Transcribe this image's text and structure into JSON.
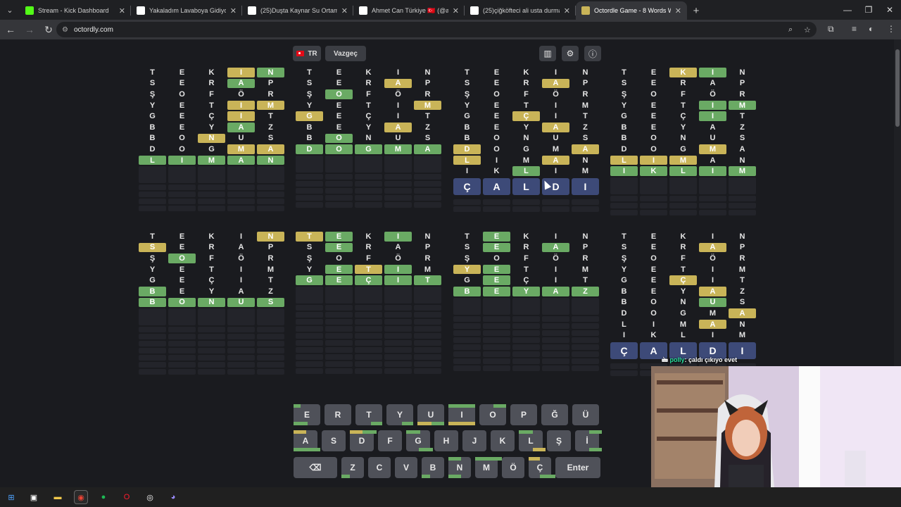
{
  "browser": {
    "tabs": [
      {
        "title": "Stream - Kick Dashboard",
        "icon": "kick-icon",
        "color": "#53fc18",
        "active": false
      },
      {
        "title": "Yakaladım Lavaboya Gidiyor, Ha",
        "icon": "tiktok-icon",
        "color": "#ffffff",
        "active": false
      },
      {
        "title": "(25)Duşta Kaynar Su Ortamı De",
        "icon": "tiktok-icon",
        "color": "#ffffff",
        "active": false
      },
      {
        "title": "Ahmet Can Türkiye 🇹🇷 (@ahmet",
        "icon": "tiktok-icon",
        "color": "#ffffff",
        "active": false
      },
      {
        "title": "(25)çiğköfteci ali usta durma de",
        "icon": "tiktok-icon",
        "color": "#ffffff",
        "active": false
      },
      {
        "title": "Octordle Game - 8 Words Word",
        "icon": "octordle-icon",
        "color": "#c9b458",
        "active": true
      }
    ],
    "url": "octordly.com"
  },
  "header": {
    "lang_label": "TR",
    "giveup_label": "Vazgeç",
    "icons": [
      "stats-icon",
      "gear-icon",
      "info-icon"
    ]
  },
  "colors": {
    "green": "#6aaa64",
    "yellow": "#c9b458",
    "current": "#3d4a78",
    "key": "#4f5159"
  },
  "boards": [
    {
      "rows": [
        [
          "T.",
          "E.",
          "K.",
          "Iy",
          "Ng"
        ],
        [
          "S.",
          "E.",
          "R.",
          "Ag",
          "P."
        ],
        [
          "Ş.",
          "O.",
          "F.",
          "Ö.",
          "R."
        ],
        [
          "Y.",
          "E.",
          "T.",
          "Iy",
          "My"
        ],
        [
          "G.",
          "E.",
          "Ç.",
          "Iy",
          "T."
        ],
        [
          "B.",
          "E.",
          "Y.",
          "Ag",
          "Z."
        ],
        [
          "B.",
          "O.",
          "Ny",
          "U.",
          "S."
        ],
        [
          "D.",
          "O.",
          "G.",
          "My",
          "Ay"
        ],
        [
          "Lg",
          "Ig",
          "Mg",
          "Ag",
          "Ng"
        ]
      ],
      "current": null
    },
    {
      "rows": [
        [
          "T.",
          "E.",
          "K.",
          "I.",
          "N."
        ],
        [
          "S.",
          "E.",
          "R.",
          "Ay",
          "P."
        ],
        [
          "Ş.",
          "Og",
          "F.",
          "Ö.",
          "R."
        ],
        [
          "Y.",
          "E.",
          "T.",
          "I.",
          "My"
        ],
        [
          "Gy",
          "E.",
          "Ç.",
          "I.",
          "T."
        ],
        [
          "B.",
          "E.",
          "Y.",
          "Ay",
          "Z."
        ],
        [
          "B.",
          "Og",
          "N.",
          "U.",
          "S."
        ],
        [
          "Dg",
          "Og",
          "Gg",
          "Mg",
          "Ag"
        ]
      ],
      "current": null
    },
    {
      "rows": [
        [
          "T.",
          "E.",
          "K.",
          "I.",
          "N."
        ],
        [
          "S.",
          "E.",
          "R.",
          "Ay",
          "P."
        ],
        [
          "Ş.",
          "O.",
          "F.",
          "Ö.",
          "R."
        ],
        [
          "Y.",
          "E.",
          "T.",
          "I.",
          "M."
        ],
        [
          "G.",
          "E.",
          "Çy",
          "I.",
          "T."
        ],
        [
          "B.",
          "E.",
          "Y.",
          "Ay",
          "Z."
        ],
        [
          "B.",
          "O.",
          "N.",
          "U.",
          "S."
        ],
        [
          "Dy",
          "O.",
          "G.",
          "M.",
          "Ay"
        ],
        [
          "Ly",
          "I.",
          "M.",
          "Ay",
          "N."
        ],
        [
          "I.",
          "K.",
          "Lg",
          "I.",
          "M."
        ]
      ],
      "current": [
        "Ç",
        "A",
        "L",
        "D",
        "I"
      ]
    },
    {
      "rows": [
        [
          "T.",
          "E.",
          "Ky",
          "Ig",
          "N."
        ],
        [
          "S.",
          "E.",
          "R.",
          "A.",
          "P."
        ],
        [
          "Ş.",
          "O.",
          "F.",
          "Ö.",
          "R."
        ],
        [
          "Y.",
          "E.",
          "T.",
          "Ig",
          "Mg"
        ],
        [
          "G.",
          "E.",
          "Ç.",
          "Ig",
          "T."
        ],
        [
          "B.",
          "E.",
          "Y.",
          "A.",
          "Z."
        ],
        [
          "B.",
          "O.",
          "N.",
          "U.",
          "S."
        ],
        [
          "D.",
          "O.",
          "G.",
          "My",
          "A."
        ],
        [
          "Ly",
          "Iy",
          "My",
          "A.",
          "N."
        ],
        [
          "Ig",
          "Kg",
          "Lg",
          "Ig",
          "Mg"
        ]
      ],
      "current": null
    },
    {
      "rows": [
        [
          "T.",
          "E.",
          "K.",
          "I.",
          "Ny"
        ],
        [
          "Sy",
          "E.",
          "R.",
          "A.",
          "P."
        ],
        [
          "Ş.",
          "Og",
          "F.",
          "Ö.",
          "R."
        ],
        [
          "Y.",
          "E.",
          "T.",
          "I.",
          "M."
        ],
        [
          "G.",
          "E.",
          "Ç.",
          "I.",
          "T."
        ],
        [
          "Bg",
          "E.",
          "Y.",
          "A.",
          "Z."
        ],
        [
          "Bg",
          "Og",
          "Ng",
          "Ug",
          "Sg"
        ]
      ],
      "current": null
    },
    {
      "rows": [
        [
          "Ty",
          "Eg",
          "K.",
          "Ig",
          "N."
        ],
        [
          "S.",
          "Eg",
          "R.",
          "A.",
          "P."
        ],
        [
          "Ş.",
          "O.",
          "F.",
          "Ö.",
          "R."
        ],
        [
          "Y.",
          "Eg",
          "Ty",
          "Ig",
          "M."
        ],
        [
          "Gg",
          "Eg",
          "Çg",
          "Ig",
          "Tg"
        ]
      ],
      "current": null
    },
    {
      "rows": [
        [
          "T.",
          "Eg",
          "K.",
          "I.",
          "N."
        ],
        [
          "S.",
          "Eg",
          "R.",
          "Ag",
          "P."
        ],
        [
          "Ş.",
          "O.",
          "F.",
          "Ö.",
          "R."
        ],
        [
          "Yy",
          "Eg",
          "T.",
          "I.",
          "M."
        ],
        [
          "G.",
          "Eg",
          "Ç.",
          "I.",
          "T."
        ],
        [
          "Bg",
          "Eg",
          "Yg",
          "Ag",
          "Zg"
        ]
      ],
      "current": null
    },
    {
      "rows": [
        [
          "T.",
          "E.",
          "K.",
          "I.",
          "N."
        ],
        [
          "S.",
          "E.",
          "R.",
          "Ay",
          "P."
        ],
        [
          "Ş.",
          "O.",
          "F.",
          "Ö.",
          "R."
        ],
        [
          "Y.",
          "E.",
          "T.",
          "I.",
          "M."
        ],
        [
          "G.",
          "E.",
          "Çy",
          "I.",
          "T."
        ],
        [
          "B.",
          "E.",
          "Y.",
          "Ay",
          "Z."
        ],
        [
          "B.",
          "O.",
          "N.",
          "Ug",
          "S."
        ],
        [
          "D.",
          "O.",
          "G.",
          "M.",
          "Ay"
        ],
        [
          "L.",
          "I.",
          "M.",
          "Ay",
          "N."
        ],
        [
          "I.",
          "K.",
          "L.",
          "I.",
          "M."
        ]
      ],
      "current": [
        "Ç",
        "A",
        "L",
        "D",
        "I"
      ]
    }
  ],
  "keyboard": {
    "row1": [
      "E",
      "R",
      "T",
      "Y",
      "U",
      "I",
      "O",
      "P",
      "Ğ",
      "Ü"
    ],
    "row2": [
      "A",
      "S",
      "D",
      "F",
      "G",
      "H",
      "J",
      "K",
      "L",
      "Ş",
      "İ"
    ],
    "row3": [
      "⌫",
      "Z",
      "C",
      "V",
      "B",
      "N",
      "M",
      "Ö",
      "Ç"
    ],
    "enter_label": "Enter"
  },
  "chat": {
    "user": "polly",
    "message": ": çaldı çıkıyo evet"
  }
}
